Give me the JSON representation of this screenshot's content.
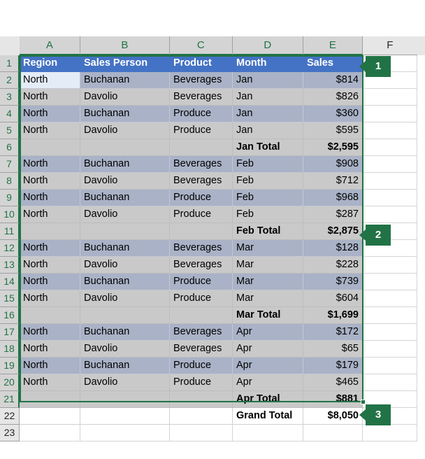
{
  "app": {
    "type": "spreadsheet",
    "name": "excel-worksheet"
  },
  "grid": {
    "column_headers": [
      "A",
      "B",
      "C",
      "D",
      "E",
      "F"
    ],
    "row_headers": [
      "1",
      "2",
      "3",
      "4",
      "5",
      "6",
      "7",
      "8",
      "9",
      "10",
      "11",
      "12",
      "13",
      "14",
      "15",
      "16",
      "17",
      "18",
      "19",
      "20",
      "21",
      "22",
      "23"
    ],
    "selected_columns": [
      "A",
      "B",
      "C",
      "D",
      "E"
    ],
    "selected_rows": [
      "1",
      "2",
      "3",
      "4",
      "5",
      "6",
      "7",
      "8",
      "9",
      "10",
      "11",
      "12",
      "13",
      "14",
      "15",
      "16",
      "17",
      "18",
      "19",
      "20",
      "21"
    ],
    "selection_range": "A1:E21",
    "active_cell": "A2",
    "select_all_icon": "select-all-triangle-icon"
  },
  "table": {
    "headers": [
      "Region",
      "Sales Person",
      "Product",
      "Month",
      "Sales"
    ],
    "rows": [
      {
        "row": "2",
        "style": "band-dark",
        "region": "North",
        "person": "Buchanan",
        "product": "Beverages",
        "month": "Jan",
        "sales": "$814"
      },
      {
        "row": "3",
        "style": "band-light",
        "region": "North",
        "person": "Davolio",
        "product": "Beverages",
        "month": "Jan",
        "sales": "$826"
      },
      {
        "row": "4",
        "style": "band-dark",
        "region": "North",
        "person": "Buchanan",
        "product": "Produce",
        "month": "Jan",
        "sales": "$360"
      },
      {
        "row": "5",
        "style": "band-light",
        "region": "North",
        "person": "Davolio",
        "product": "Produce",
        "month": "Jan",
        "sales": "$595"
      },
      {
        "row": "6",
        "style": "subtotal",
        "region": "",
        "person": "",
        "product": "",
        "month": "Jan Total",
        "sales": "$2,595"
      },
      {
        "row": "7",
        "style": "band-dark",
        "region": "North",
        "person": "Buchanan",
        "product": "Beverages",
        "month": "Feb",
        "sales": "$908"
      },
      {
        "row": "8",
        "style": "band-light",
        "region": "North",
        "person": "Davolio",
        "product": "Beverages",
        "month": "Feb",
        "sales": "$712"
      },
      {
        "row": "9",
        "style": "band-dark",
        "region": "North",
        "person": "Buchanan",
        "product": "Produce",
        "month": "Feb",
        "sales": "$968"
      },
      {
        "row": "10",
        "style": "band-light",
        "region": "North",
        "person": "Davolio",
        "product": "Produce",
        "month": "Feb",
        "sales": "$287"
      },
      {
        "row": "11",
        "style": "subtotal",
        "region": "",
        "person": "",
        "product": "",
        "month": "Feb Total",
        "sales": "$2,875"
      },
      {
        "row": "12",
        "style": "band-dark",
        "region": "North",
        "person": "Buchanan",
        "product": "Beverages",
        "month": "Mar",
        "sales": "$128"
      },
      {
        "row": "13",
        "style": "band-light",
        "region": "North",
        "person": "Davolio",
        "product": "Beverages",
        "month": "Mar",
        "sales": "$228"
      },
      {
        "row": "14",
        "style": "band-dark",
        "region": "North",
        "person": "Buchanan",
        "product": "Produce",
        "month": "Mar",
        "sales": "$739"
      },
      {
        "row": "15",
        "style": "band-light",
        "region": "North",
        "person": "Davolio",
        "product": "Produce",
        "month": "Mar",
        "sales": "$604"
      },
      {
        "row": "16",
        "style": "subtotal",
        "region": "",
        "person": "",
        "product": "",
        "month": "Mar Total",
        "sales": "$1,699"
      },
      {
        "row": "17",
        "style": "band-dark",
        "region": "North",
        "person": "Buchanan",
        "product": "Beverages",
        "month": "Apr",
        "sales": "$172"
      },
      {
        "row": "18",
        "style": "band-light",
        "region": "North",
        "person": "Davolio",
        "product": "Beverages",
        "month": "Apr",
        "sales": "$65"
      },
      {
        "row": "19",
        "style": "band-dark",
        "region": "North",
        "person": "Buchanan",
        "product": "Produce",
        "month": "Apr",
        "sales": "$179"
      },
      {
        "row": "20",
        "style": "band-light",
        "region": "North",
        "person": "Davolio",
        "product": "Produce",
        "month": "Apr",
        "sales": "$465"
      },
      {
        "row": "21",
        "style": "subtotal",
        "region": "",
        "person": "",
        "product": "",
        "month": "Apr Total",
        "sales": "$881"
      },
      {
        "row": "22",
        "style": "grand",
        "region": "",
        "person": "",
        "product": "",
        "month": "Grand Total",
        "sales": "$8,050"
      },
      {
        "row": "23",
        "style": "blank",
        "region": "",
        "person": "",
        "product": "",
        "month": "",
        "sales": ""
      }
    ]
  },
  "callouts": [
    {
      "label": "1",
      "target_row": "1",
      "description": "header-row-callout"
    },
    {
      "label": "2",
      "target_row": "11",
      "description": "subtotal-row-callout"
    },
    {
      "label": "3",
      "target_row": "22",
      "description": "grand-total-row-callout"
    }
  ],
  "colors": {
    "header_fill": "#4472C4",
    "header_text": "#FFFFFF",
    "band_dark": "#A9B2C6",
    "band_light": "#C9C9C9",
    "selection_border": "#217346",
    "callout_fill": "#217346",
    "active_cell_fill": "#E4ECF7"
  }
}
